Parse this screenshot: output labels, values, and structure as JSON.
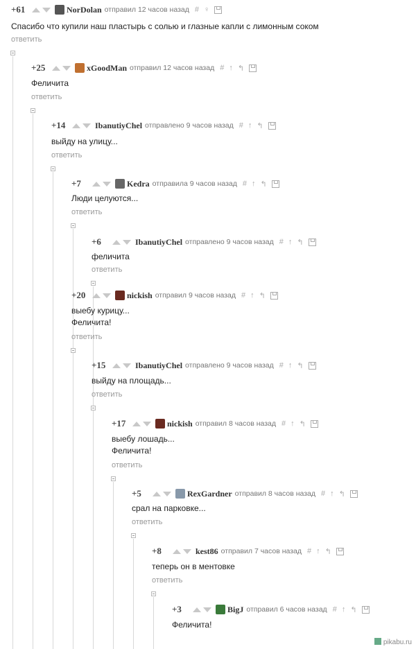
{
  "comments": [
    {
      "rating": "+61",
      "user": "NorDolan",
      "meta": "отправил 12 часов назад",
      "text": "Спасибо что купили наш пластырь с солью и глазные капли с лимонным соком",
      "reply": "ответить",
      "tools": [
        "#",
        "♀"
      ],
      "avatar_icon": "knight-helmet-icon",
      "avatar_color": "#555555"
    },
    {
      "rating": "+25",
      "user": "xGoodMan",
      "meta": "отправил 12 часов назад",
      "text": "Феличита",
      "reply": "ответить",
      "tools": [
        "#",
        "↑",
        "↰"
      ],
      "avatar_icon": "pixel-face-icon",
      "avatar_color": "#c07030"
    },
    {
      "rating": "+14",
      "user": "IbanutiyChel",
      "meta": "отправлено 9 часов назад",
      "text": "выйду на улицу...",
      "reply": "ответить",
      "tools": [
        "#",
        "↑",
        "↰"
      ],
      "avatar_icon": "",
      "avatar_color": ""
    },
    {
      "rating": "+7",
      "user": "Kedra",
      "meta": "отправила 9 часов назад",
      "text": "Люди целуются...",
      "reply": "ответить",
      "tools": [
        "#",
        "↑",
        "↰"
      ],
      "avatar_icon": "sketch-avatar-icon",
      "avatar_color": "#666666"
    },
    {
      "rating": "+6",
      "user": "IbanutiyChel",
      "meta": "отправлено 9 часов назад",
      "text": "феличита",
      "reply": "ответить",
      "tools": [
        "#",
        "↑",
        "↰"
      ],
      "avatar_icon": "",
      "avatar_color": ""
    },
    {
      "rating": "+20",
      "user": "nickish",
      "meta": "отправил 9 часов назад",
      "text": "выебу курицу...\nФеличита!",
      "reply": "ответить",
      "tools": [
        "#",
        "↑",
        "↰"
      ],
      "avatar_icon": "dark-portrait-icon",
      "avatar_color": "#6a2a20"
    },
    {
      "rating": "+15",
      "user": "IbanutiyChel",
      "meta": "отправлено 9 часов назад",
      "text": "выйду на площадь...",
      "reply": "ответить",
      "tools": [
        "#",
        "↑",
        "↰"
      ],
      "avatar_icon": "",
      "avatar_color": ""
    },
    {
      "rating": "+17",
      "user": "nickish",
      "meta": "отправил 8 часов назад",
      "text": "выебу лошадь...\nФеличита!",
      "reply": "ответить",
      "tools": [
        "#",
        "↑",
        "↰"
      ],
      "avatar_icon": "dark-portrait-icon",
      "avatar_color": "#6a2a20"
    },
    {
      "rating": "+5",
      "user": "RexGardner",
      "meta": "отправил 8 часов назад",
      "text": "срал на парковке...",
      "reply": "ответить",
      "tools": [
        "#",
        "↑",
        "↰"
      ],
      "avatar_icon": "photo-avatar-icon",
      "avatar_color": "#8899aa"
    },
    {
      "rating": "+8",
      "user": "kest86",
      "meta": "отправил 7 часов назад",
      "text": "теперь он в ментовке",
      "reply": "ответить",
      "tools": [
        "#",
        "↑",
        "↰"
      ],
      "avatar_icon": "",
      "avatar_color": ""
    },
    {
      "rating": "+3",
      "user": "BigJ",
      "meta": "отправил 6 часов назад",
      "text": "Феличита!",
      "reply": "",
      "tools": [
        "#",
        "↑",
        "↰"
      ],
      "avatar_icon": "green-figure-icon",
      "avatar_color": "#3a7a3a"
    }
  ],
  "watermark": "pikabu.ru"
}
